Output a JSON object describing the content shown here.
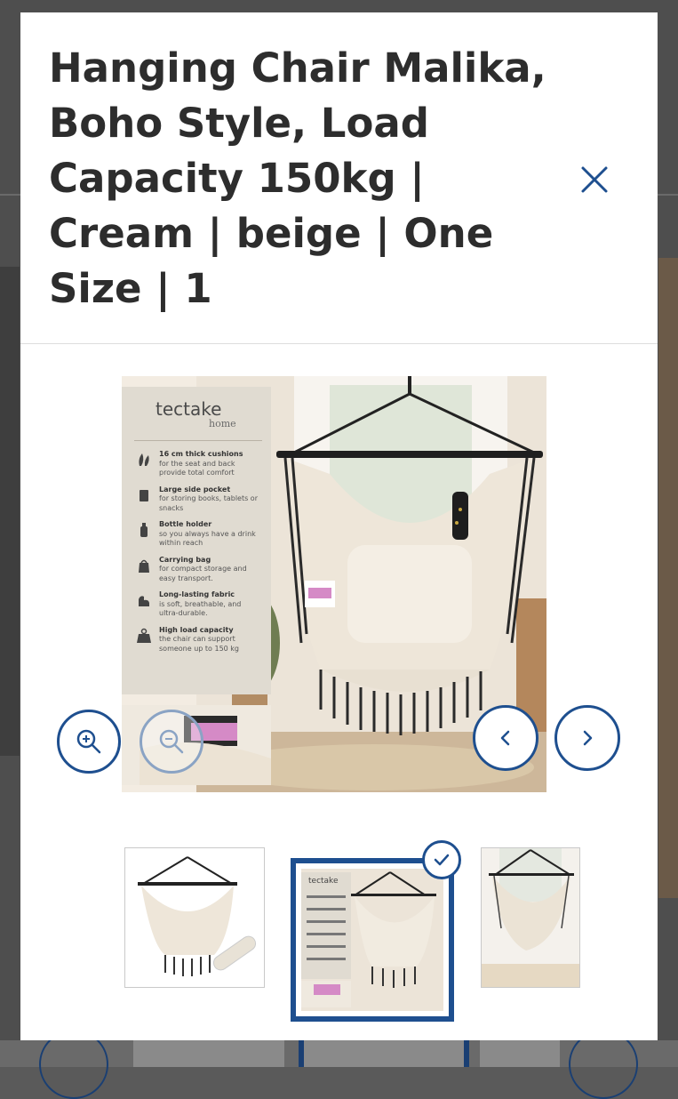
{
  "modal": {
    "title": "Hanging Chair Malika, Boho Style, Load Capacity 150kg | Cream | beige | One Size | 1",
    "close_icon": "close-icon"
  },
  "main_image": {
    "brand": "tectake",
    "brand_sub": "home",
    "features": [
      {
        "icon": "cushion-icon",
        "title": "16 cm thick cushions",
        "text": "for the seat and back provide total comfort"
      },
      {
        "icon": "pocket-icon",
        "title": "Large side pocket",
        "text": "for storing books, tablets or snacks"
      },
      {
        "icon": "bottle-icon",
        "title": "Bottle holder",
        "text": "so you always have a drink within reach"
      },
      {
        "icon": "bag-icon",
        "title": "Carrying bag",
        "text": "for compact storage and easy transport."
      },
      {
        "icon": "arm-icon",
        "title": "Long-lasting fabric",
        "text": "is soft, breathable, and ultra-durable."
      },
      {
        "icon": "weight-kg-icon",
        "title": "High load capacity",
        "text": "the chair can support someone up to 150 kg"
      }
    ]
  },
  "controls": {
    "zoom_in_icon": "zoom-in-icon",
    "zoom_out_icon": "zoom-out-icon",
    "prev_icon": "chevron-left-icon",
    "next_icon": "chevron-right-icon"
  },
  "thumbnails": {
    "count_visible": 3,
    "selected_index": 1,
    "check_icon": "checkmark-icon"
  },
  "colors": {
    "accent": "#1e4f8f",
    "title_text": "#2d2d2d",
    "modal_bg": "#ffffff"
  }
}
